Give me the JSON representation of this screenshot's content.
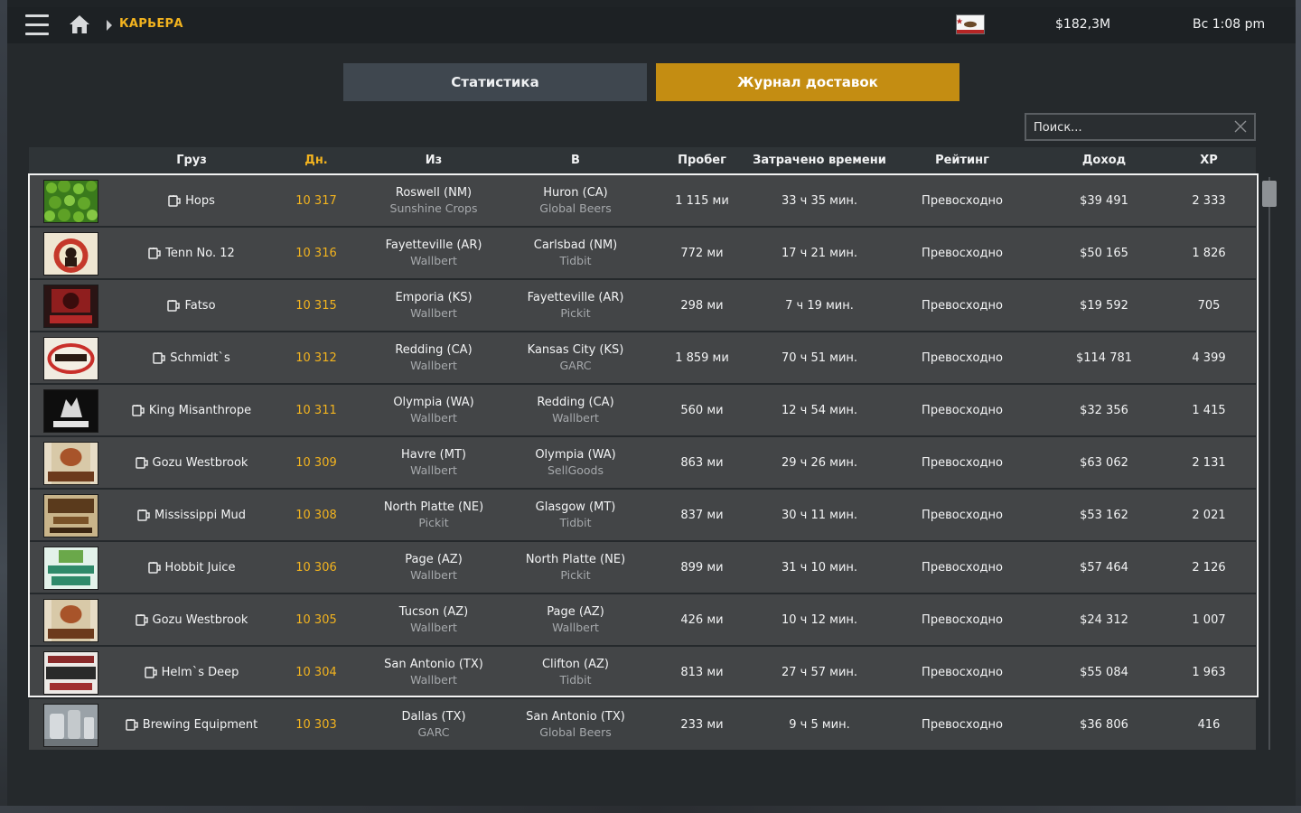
{
  "header": {
    "breadcrumb": "КАРЬЕРА",
    "money": "$182,3M",
    "clock": "Вс 1:08 pm"
  },
  "tabs": [
    {
      "label": "Статистика",
      "active": false
    },
    {
      "label": "Журнал доставок",
      "active": true
    }
  ],
  "search": {
    "placeholder": "Поиск...",
    "value": ""
  },
  "colors": {
    "accent": "#f2b31f",
    "active_tab": "#c48d12"
  },
  "columns": {
    "cargo": "Груз",
    "day": "Дн.",
    "from": "Из",
    "to": "В",
    "distance": "Пробег",
    "time": "Затрачено времени",
    "rating": "Рейтинг",
    "income": "Доход",
    "xp": "XP"
  },
  "rows": [
    {
      "cargo": "Hops",
      "day": "10 317",
      "from_city": "Roswell (NM)",
      "from_company": "Sunshine Crops",
      "to_city": "Huron (CA)",
      "to_company": "Global Beers",
      "distance": "1 115 ми",
      "time": "33 ч 35 мин.",
      "rating": "Превосходно",
      "income": "$39 491",
      "xp": "2 333"
    },
    {
      "cargo": "Tenn No. 12",
      "day": "10 316",
      "from_city": "Fayetteville (AR)",
      "from_company": "Wallbert",
      "to_city": "Carlsbad (NM)",
      "to_company": "Tidbit",
      "distance": "772 ми",
      "time": "17 ч 21 мин.",
      "rating": "Превосходно",
      "income": "$50 165",
      "xp": "1 826"
    },
    {
      "cargo": "Fatso",
      "day": "10 315",
      "from_city": "Emporia (KS)",
      "from_company": "Wallbert",
      "to_city": "Fayetteville (AR)",
      "to_company": "Pickit",
      "distance": "298 ми",
      "time": "7 ч 19 мин.",
      "rating": "Превосходно",
      "income": "$19 592",
      "xp": "705"
    },
    {
      "cargo": "Schmidt`s",
      "day": "10 312",
      "from_city": "Redding (CA)",
      "from_company": "Wallbert",
      "to_city": "Kansas City (KS)",
      "to_company": "GARC",
      "distance": "1 859 ми",
      "time": "70 ч 51 мин.",
      "rating": "Превосходно",
      "income": "$114 781",
      "xp": "4 399"
    },
    {
      "cargo": "King Misanthrope",
      "day": "10 311",
      "from_city": "Olympia (WA)",
      "from_company": "Wallbert",
      "to_city": "Redding (CA)",
      "to_company": "Wallbert",
      "distance": "560 ми",
      "time": "12 ч 54 мин.",
      "rating": "Превосходно",
      "income": "$32 356",
      "xp": "1 415"
    },
    {
      "cargo": "Gozu Westbrook",
      "day": "10 309",
      "from_city": "Havre (MT)",
      "from_company": "Wallbert",
      "to_city": "Olympia (WA)",
      "to_company": "SellGoods",
      "distance": "863 ми",
      "time": "29 ч 26 мин.",
      "rating": "Превосходно",
      "income": "$63 062",
      "xp": "2 131"
    },
    {
      "cargo": "Mississippi Mud",
      "day": "10 308",
      "from_city": "North Platte (NE)",
      "from_company": "Pickit",
      "to_city": "Glasgow (MT)",
      "to_company": "Tidbit",
      "distance": "837 ми",
      "time": "30 ч 11 мин.",
      "rating": "Превосходно",
      "income": "$53 162",
      "xp": "2 021"
    },
    {
      "cargo": "Hobbit Juice",
      "day": "10 306",
      "from_city": "Page (AZ)",
      "from_company": "Wallbert",
      "to_city": "North Platte (NE)",
      "to_company": "Pickit",
      "distance": "899 ми",
      "time": "31 ч 10 мин.",
      "rating": "Превосходно",
      "income": "$57 464",
      "xp": "2 126"
    },
    {
      "cargo": "Gozu Westbrook",
      "day": "10 305",
      "from_city": "Tucson (AZ)",
      "from_company": "Wallbert",
      "to_city": "Page (AZ)",
      "to_company": "Wallbert",
      "distance": "426 ми",
      "time": "10 ч 12 мин.",
      "rating": "Превосходно",
      "income": "$24 312",
      "xp": "1 007"
    },
    {
      "cargo": "Helm`s Deep",
      "day": "10 304",
      "from_city": "San Antonio (TX)",
      "from_company": "Wallbert",
      "to_city": "Clifton (AZ)",
      "to_company": "Tidbit",
      "distance": "813 ми",
      "time": "27 ч 57 мин.",
      "rating": "Превосходно",
      "income": "$55 084",
      "xp": "1 963"
    },
    {
      "cargo": "Brewing Equipment",
      "day": "10 303",
      "from_city": "Dallas (TX)",
      "from_company": "GARC",
      "to_city": "San Antonio (TX)",
      "to_company": "Global Beers",
      "distance": "233 ми",
      "time": "9 ч 5 мин.",
      "rating": "Превосходно",
      "income": "$36 806",
      "xp": "416"
    }
  ]
}
